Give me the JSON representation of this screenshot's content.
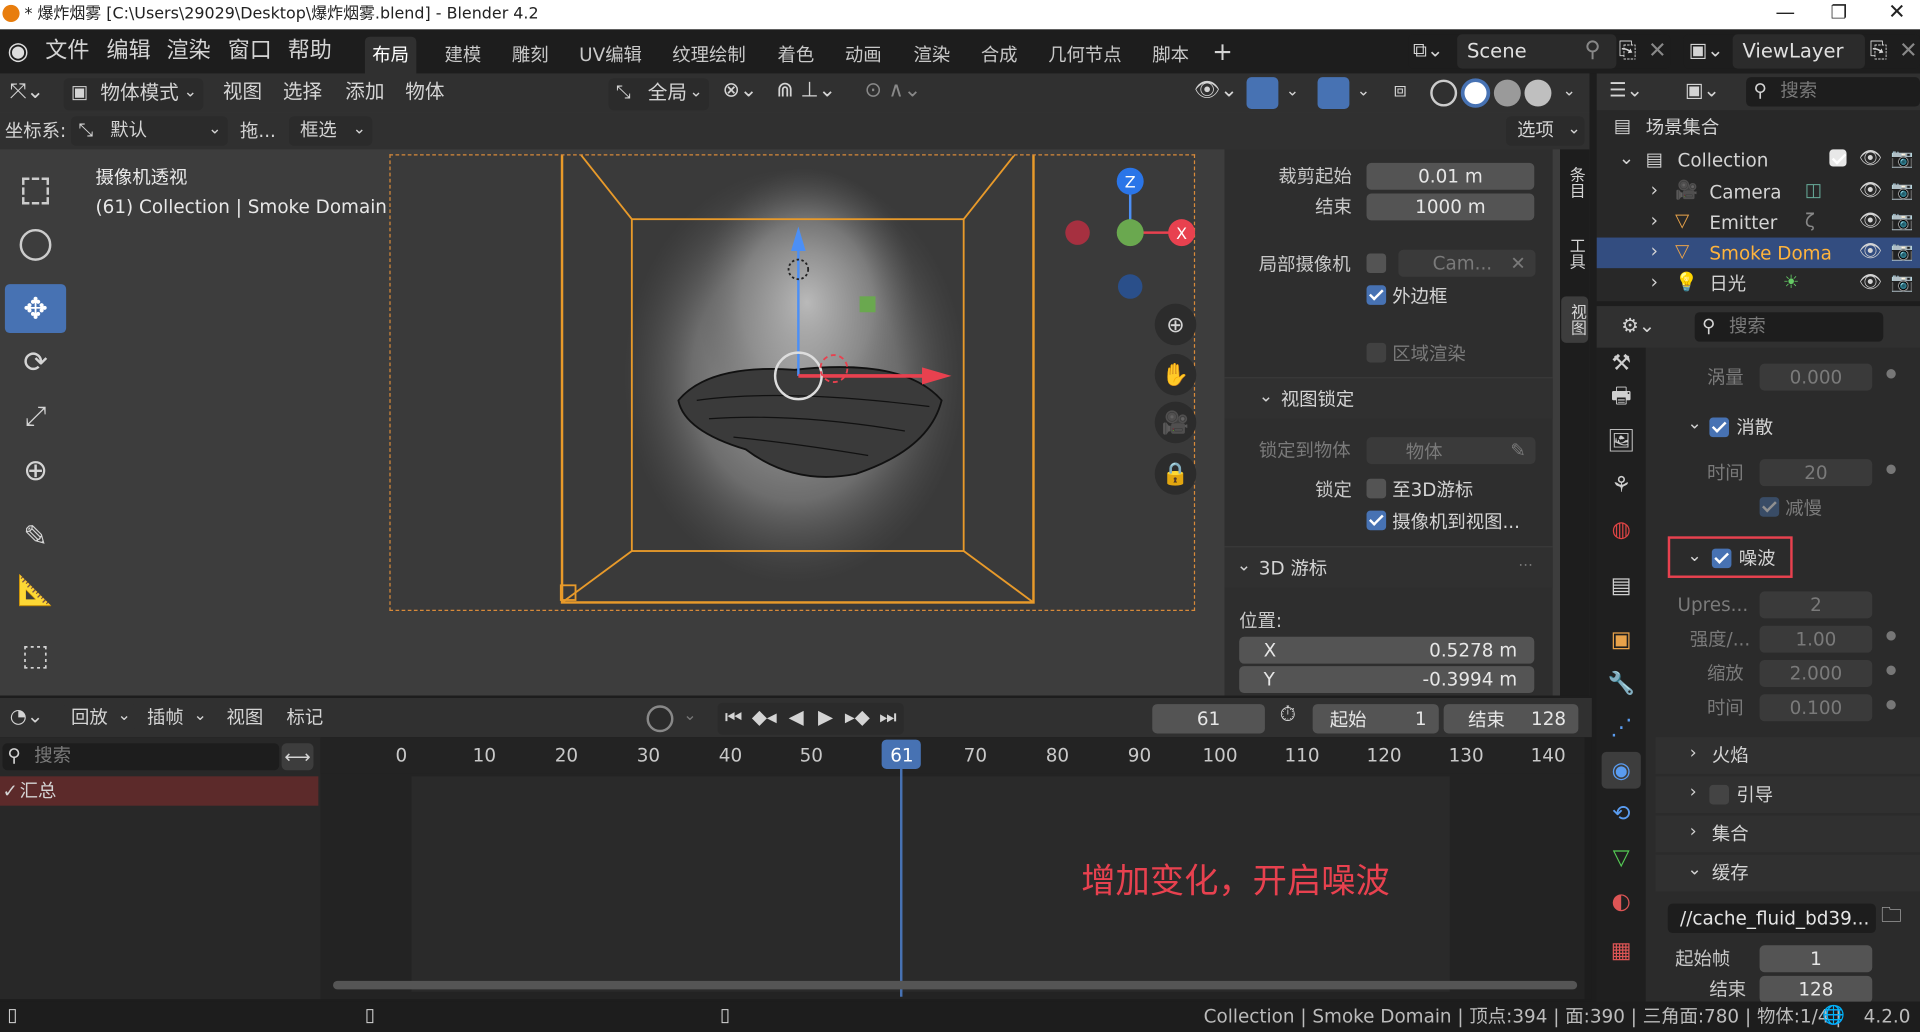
{
  "titlebar": {
    "title": "* 爆炸烟雾 [C:\\Users\\29029\\Desktop\\爆炸烟雾.blend] - Blender 4.2"
  },
  "menu": [
    "文件",
    "编辑",
    "渲染",
    "窗口",
    "帮助"
  ],
  "workspaces": [
    "布局",
    "建模",
    "雕刻",
    "UV编辑",
    "纹理绘制",
    "着色",
    "动画",
    "渲染",
    "合成",
    "几何节点",
    "脚本"
  ],
  "scene": {
    "name": "Scene",
    "viewlayer": "ViewLayer"
  },
  "header": {
    "mode": "物体模式",
    "view": "视图",
    "select": "选择",
    "add": "添加",
    "object": "物体",
    "transform": "全局"
  },
  "header2": {
    "coord_label": "坐标系:",
    "coord_value": "默认",
    "drag": "拖...",
    "select_mode": "框选",
    "options": "选项"
  },
  "viewport": {
    "title": "摄像机透视",
    "subtitle": "(61) Collection | Smoke Domain"
  },
  "npanel": {
    "clip_start_label": "裁剪起始",
    "clip_start": "0.01 m",
    "clip_end_label": "结束",
    "clip_end": "1000 m",
    "local_cam_label": "局部摄像机",
    "local_cam_value": "Cam...",
    "outer_frame": "外边框",
    "region_render": "区域渲染",
    "view_lock": "视图锁定",
    "lock_to_obj_label": "锁定到物体",
    "lock_to_obj_value": "物体",
    "lock_label": "锁定",
    "lock_3d_cursor": "至3D游标",
    "cam_to_view": "摄像机到视图...",
    "cursor_section": "3D 游标",
    "location": "位置:",
    "x_label": "X",
    "x_value": "0.5278 m",
    "y_label": "Y",
    "y_value": "-0.3994 m",
    "tabs": [
      "条目",
      "工具",
      "视图"
    ]
  },
  "outliner": {
    "search_placeholder": "搜索",
    "root": "场景集合",
    "collection": "Collection",
    "items": [
      "Camera",
      "Emitter",
      "Smoke Doma",
      "日光"
    ]
  },
  "properties": {
    "search_placeholder": "搜索",
    "vorticity_label": "涡量",
    "vorticity": "0.000",
    "dissolve": "消散",
    "time_label": "时间",
    "time_value": "20",
    "slow": "减慢",
    "noise": "噪波",
    "upres_label": "Upres...",
    "upres": "2",
    "strength_label": "强度/...",
    "strength": "1.00",
    "scale_label": "缩放",
    "scale": "2.000",
    "ntime_label": "时间",
    "ntime": "0.100",
    "fire": "火焰",
    "guide": "引导",
    "collections": "集合",
    "cache": "缓存",
    "cache_path": "//cache_fluid_bd39...",
    "start_label": "起始帧",
    "start": "1",
    "end_label": "结束",
    "end": "128"
  },
  "timeline": {
    "playback": "回放",
    "keying": "插帧",
    "view": "视图",
    "marker": "标记",
    "current_frame": "61",
    "start_label": "起始",
    "start": "1",
    "end_label": "结束",
    "end": "128",
    "search_placeholder": "搜索",
    "summary": "汇总",
    "ruler": [
      "0",
      "10",
      "20",
      "30",
      "40",
      "50",
      "61",
      "70",
      "80",
      "90",
      "100",
      "110",
      "120",
      "130",
      "140"
    ]
  },
  "annotation": "增加变化，开启噪波",
  "statusbar": {
    "text": "Collection | Smoke Domain | 顶点:394 | 面:390 | 三角面:780 | 物体:1/4 | ",
    "version": "4.2.0"
  }
}
